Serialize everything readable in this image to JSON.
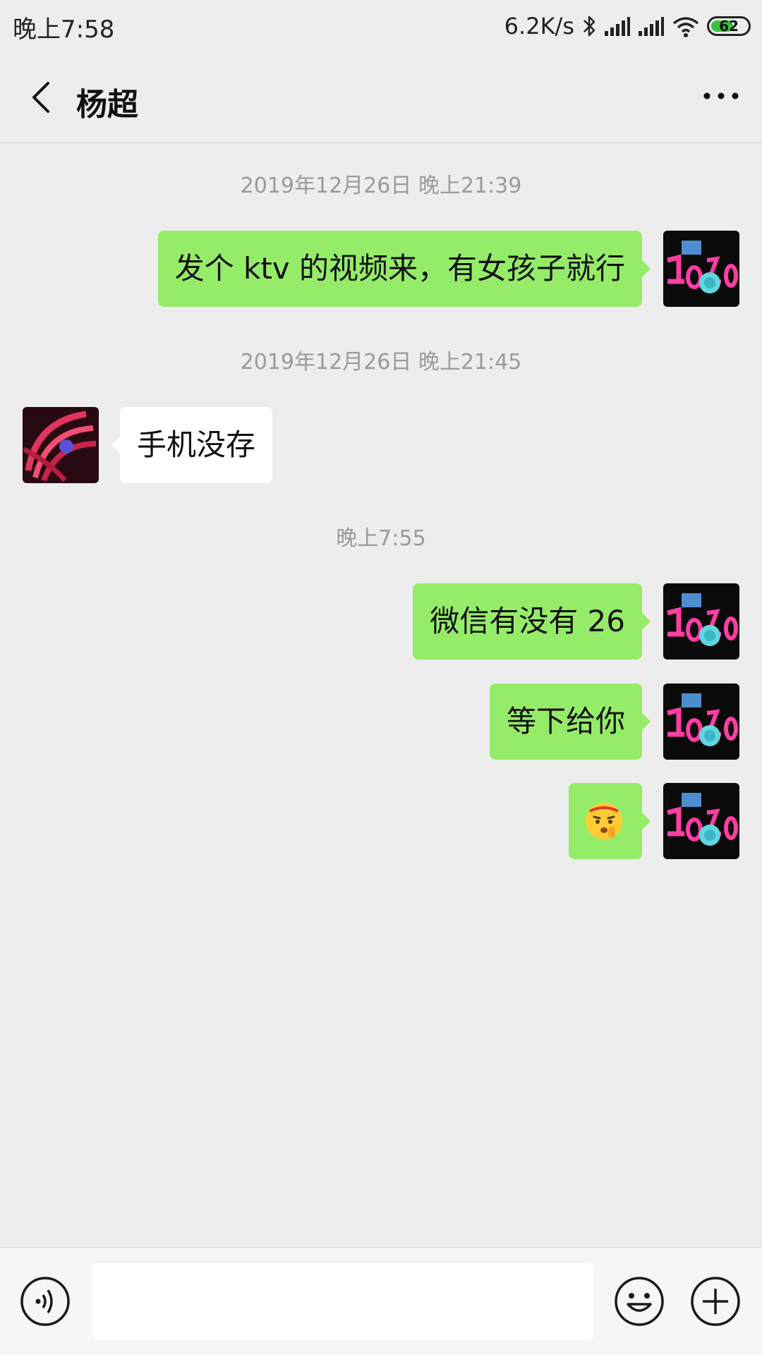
{
  "status_bar": {
    "time": "晚上7:58",
    "network_speed": "6.2K/s",
    "battery_level": "62",
    "battery_fill_fraction": 0.62,
    "battery_color": "#36c23a",
    "icons": [
      "bluetooth-icon",
      "signal-icon",
      "signal-icon",
      "wifi-icon",
      "battery-icon"
    ]
  },
  "header": {
    "title": "杨超",
    "back_icon": "chevron-left-icon",
    "more_icon": "more-dots-icon"
  },
  "colors": {
    "background": "#ededed",
    "my_bubble": "#95ec69",
    "other_bubble": "#ffffff",
    "timestamp_text": "#9a9a9a"
  },
  "messages": [
    {
      "type": "timestamp",
      "text": "2019年12月26日 晚上21:39"
    },
    {
      "type": "message",
      "sender": "me",
      "text": "发个 ktv 的视频来，有女孩子就行"
    },
    {
      "type": "timestamp",
      "text": "2019年12月26日 晚上21:45"
    },
    {
      "type": "message",
      "sender": "other",
      "text": "手机没存"
    },
    {
      "type": "timestamp",
      "text": "晚上7:55"
    },
    {
      "type": "message",
      "sender": "me",
      "text": "微信有没有 26"
    },
    {
      "type": "message",
      "sender": "me",
      "text": "等下给你"
    },
    {
      "type": "message",
      "sender": "me",
      "content": "emoji",
      "emoji": "shush-face-emoji"
    }
  ],
  "input_bar": {
    "message_value": "",
    "voice_icon": "voice-icon",
    "emoji_icon": "emoji-icon",
    "plus_icon": "plus-icon"
  }
}
